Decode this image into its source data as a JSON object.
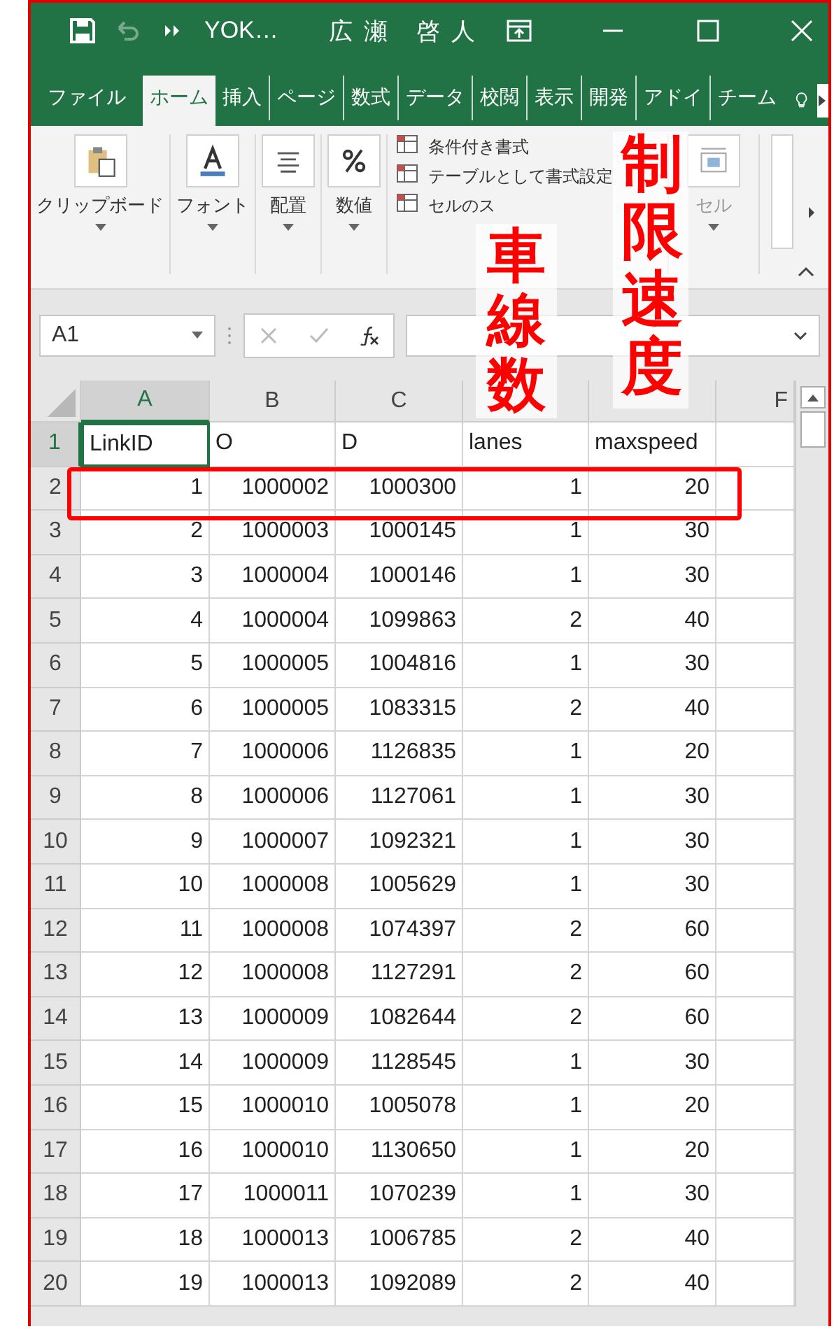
{
  "title_bar": {
    "title": "YOK…",
    "user": "広瀬 啓人"
  },
  "tabs": [
    {
      "label": "ファイル",
      "selected": false
    },
    {
      "label": "ホーム",
      "selected": true
    },
    {
      "label": "挿入",
      "selected": false
    },
    {
      "label": "ページ",
      "selected": false
    },
    {
      "label": "数式",
      "selected": false
    },
    {
      "label": "データ",
      "selected": false
    },
    {
      "label": "校閲",
      "selected": false
    },
    {
      "label": "表示",
      "selected": false
    },
    {
      "label": "開発",
      "selected": false
    },
    {
      "label": "アドイ",
      "selected": false
    },
    {
      "label": "チーム",
      "selected": false
    }
  ],
  "ribbon": {
    "groups": [
      {
        "kind": "big",
        "label": "クリップボード"
      },
      {
        "kind": "big",
        "label": "フォント"
      },
      {
        "kind": "big",
        "label": "配置"
      },
      {
        "kind": "big",
        "label": "数値"
      },
      {
        "kind": "styles",
        "items": [
          "条件付き書式",
          "テーブルとして書式設定",
          "セルのス"
        ]
      },
      {
        "kind": "cells",
        "label": "セル"
      }
    ]
  },
  "formula_bar": {
    "name_box": "A1"
  },
  "columns": [
    {
      "label": "A",
      "selected": true
    },
    {
      "label": "B",
      "selected": false
    },
    {
      "label": "C",
      "selected": false
    },
    {
      "selected": false
    },
    {
      "selected": false
    },
    {
      "label": "F",
      "selected": false
    }
  ],
  "rows": [
    {
      "number": "1",
      "kind": "text",
      "selected": true,
      "highlighted": false,
      "cells": [
        "LinkID",
        "O",
        "D",
        "lanes",
        "maxspeed"
      ]
    },
    {
      "number": "2",
      "kind": "number",
      "selected": false,
      "highlighted": true,
      "cells": [
        "1",
        "1000002",
        "1000300",
        "1",
        "20"
      ]
    },
    {
      "number": "3",
      "kind": "number",
      "selected": false,
      "highlighted": false,
      "cells": [
        "2",
        "1000003",
        "1000145",
        "1",
        "30"
      ]
    },
    {
      "number": "4",
      "kind": "number",
      "selected": false,
      "highlighted": false,
      "cells": [
        "3",
        "1000004",
        "1000146",
        "1",
        "30"
      ]
    },
    {
      "number": "5",
      "kind": "number",
      "selected": false,
      "highlighted": false,
      "cells": [
        "4",
        "1000004",
        "1099863",
        "2",
        "40"
      ]
    },
    {
      "number": "6",
      "kind": "number",
      "selected": false,
      "highlighted": false,
      "cells": [
        "5",
        "1000005",
        "1004816",
        "1",
        "30"
      ]
    },
    {
      "number": "7",
      "kind": "number",
      "selected": false,
      "highlighted": false,
      "cells": [
        "6",
        "1000005",
        "1083315",
        "2",
        "40"
      ]
    },
    {
      "number": "8",
      "kind": "number",
      "selected": false,
      "highlighted": false,
      "cells": [
        "7",
        "1000006",
        "1126835",
        "1",
        "20"
      ]
    },
    {
      "number": "9",
      "kind": "number",
      "selected": false,
      "highlighted": false,
      "cells": [
        "8",
        "1000006",
        "1127061",
        "1",
        "30"
      ]
    },
    {
      "number": "10",
      "kind": "number",
      "selected": false,
      "highlighted": false,
      "cells": [
        "9",
        "1000007",
        "1092321",
        "1",
        "30"
      ]
    },
    {
      "number": "11",
      "kind": "number",
      "selected": false,
      "highlighted": false,
      "cells": [
        "10",
        "1000008",
        "1005629",
        "1",
        "30"
      ]
    },
    {
      "number": "12",
      "kind": "number",
      "selected": false,
      "highlighted": false,
      "cells": [
        "11",
        "1000008",
        "1074397",
        "2",
        "60"
      ]
    },
    {
      "number": "13",
      "kind": "number",
      "selected": false,
      "highlighted": false,
      "cells": [
        "12",
        "1000008",
        "1127291",
        "2",
        "60"
      ]
    },
    {
      "number": "14",
      "kind": "number",
      "selected": false,
      "highlighted": false,
      "cells": [
        "13",
        "1000009",
        "1082644",
        "2",
        "60"
      ]
    },
    {
      "number": "15",
      "kind": "number",
      "selected": false,
      "highlighted": false,
      "cells": [
        "14",
        "1000009",
        "1128545",
        "1",
        "30"
      ]
    },
    {
      "number": "16",
      "kind": "number",
      "selected": false,
      "highlighted": false,
      "cells": [
        "15",
        "1000010",
        "1005078",
        "1",
        "20"
      ]
    },
    {
      "number": "17",
      "kind": "number",
      "selected": false,
      "highlighted": false,
      "cells": [
        "16",
        "1000010",
        "1130650",
        "1",
        "20"
      ]
    },
    {
      "number": "18",
      "kind": "number",
      "selected": false,
      "highlighted": false,
      "cells": [
        "17",
        "1000011",
        "1070239",
        "1",
        "30"
      ]
    },
    {
      "number": "19",
      "kind": "number",
      "selected": false,
      "highlighted": false,
      "cells": [
        "18",
        "1000013",
        "1006785",
        "2",
        "40"
      ]
    },
    {
      "number": "20",
      "kind": "number",
      "selected": false,
      "highlighted": false,
      "cells": [
        "19",
        "1000013",
        "1092089",
        "2",
        "40"
      ]
    }
  ],
  "annotations": [
    {
      "text": "車線数"
    },
    {
      "text": "制限速度"
    }
  ]
}
